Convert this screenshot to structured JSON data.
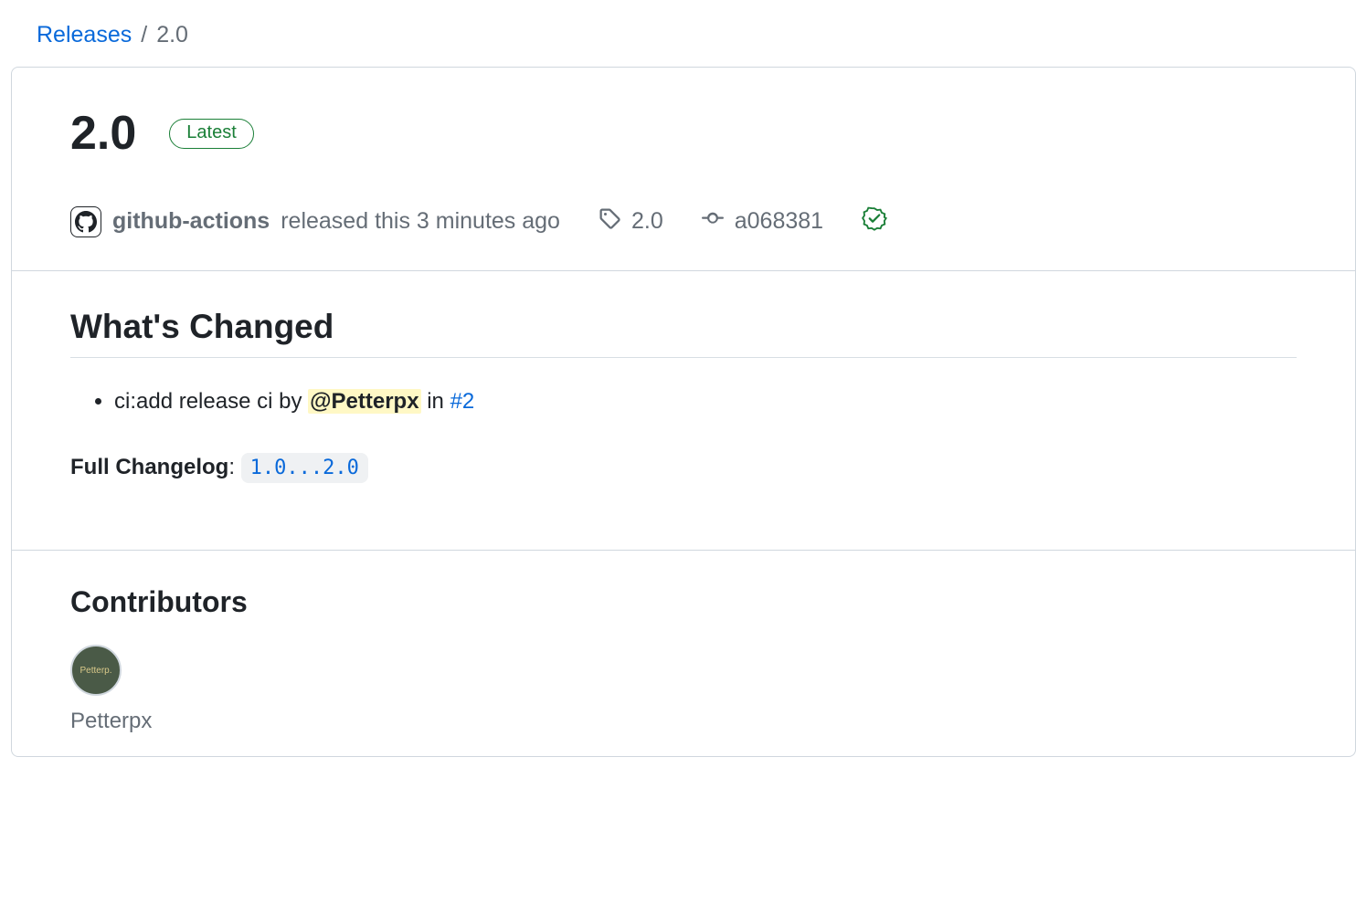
{
  "breadcrumb": {
    "root": "Releases",
    "separator": "/",
    "current": "2.0"
  },
  "release": {
    "title": "2.0",
    "latest_label": "Latest",
    "publisher": "github-actions",
    "published_text": "released this 3 minutes ago",
    "tag": "2.0",
    "commit": "a068381"
  },
  "body": {
    "heading": "What's Changed",
    "item_prefix": "ci:add release ci by ",
    "item_mention": "@Petterpx",
    "item_in": " in ",
    "item_pr": "#2",
    "full_changelog_label": "Full Changelog",
    "full_changelog_colon": ": ",
    "compare_link": "1.0...2.0"
  },
  "contributors": {
    "heading": "Contributors",
    "items": [
      {
        "name": "Petterpx",
        "avatar_text": "Petterp."
      }
    ]
  }
}
